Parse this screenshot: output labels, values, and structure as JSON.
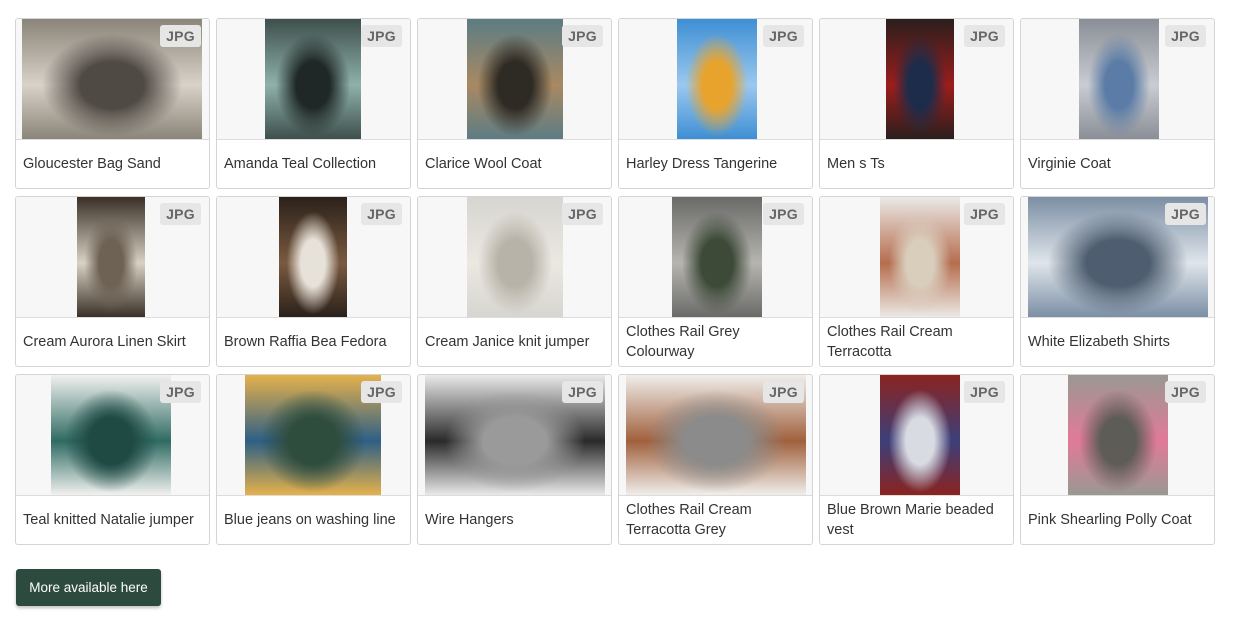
{
  "products": [
    {
      "name": "Gloucester Bag Sand",
      "badge": "JPG",
      "image": "white handbag on wall",
      "colors": [
        "#8a8479",
        "#d8d2c8",
        "#4f4a44"
      ]
    },
    {
      "name": "Amanda Teal Collection",
      "badge": "JPG",
      "image": "two women in teal suits",
      "colors": [
        "#3e4f4c",
        "#8fb1aa",
        "#1f2826"
      ]
    },
    {
      "name": "Clarice Wool Coat",
      "badge": "JPG",
      "image": "woman in camel coat",
      "colors": [
        "#5d7c84",
        "#a88962",
        "#2e2a24"
      ]
    },
    {
      "name": "Harley Dress Tangerine",
      "badge": "JPG",
      "image": "orange dress against sky",
      "colors": [
        "#3f8fd4",
        "#9ac8ee",
        "#e8a32c"
      ]
    },
    {
      "name": "Men s Ts",
      "badge": "JPG",
      "image": "folded t-shirts",
      "colors": [
        "#2a1f1d",
        "#9b1d1d",
        "#1d2c4a"
      ]
    },
    {
      "name": "Virginie Coat",
      "badge": "JPG",
      "image": "woman in blue coat at cathedral",
      "colors": [
        "#8a8e96",
        "#c9ccd2",
        "#5b7ca6"
      ]
    },
    {
      "name": "Cream Aurora Linen Skirt",
      "badge": "JPG",
      "image": "linen skirt",
      "colors": [
        "#3a3027",
        "#d9d2c4",
        "#6e6255"
      ]
    },
    {
      "name": "Brown Raffia Bea Fedora",
      "badge": "JPG",
      "image": "brown fedora hat",
      "colors": [
        "#2b211a",
        "#7a5a40",
        "#e7e2d9"
      ]
    },
    {
      "name": "Cream Janice knit jumper",
      "badge": "JPG",
      "image": "cream knit jumper",
      "colors": [
        "#d7d5d0",
        "#ebe8e2",
        "#b8b3a8"
      ]
    },
    {
      "name": "Clothes Rail Grey Colourway",
      "badge": "JPG",
      "image": "clothes rail with plant",
      "colors": [
        "#6a6a68",
        "#b6b5b0",
        "#3d4a38"
      ]
    },
    {
      "name": "Clothes Rail Cream Terracotta",
      "badge": "JPG",
      "image": "clothes rail cream terracotta",
      "colors": [
        "#ebe9e6",
        "#b56d4e",
        "#d9cdbc"
      ]
    },
    {
      "name": "White Elizabeth Shirts",
      "badge": "JPG",
      "image": "white shirts on hangers",
      "colors": [
        "#7c8fa4",
        "#dfe5eb",
        "#4e5e70"
      ]
    },
    {
      "name": "Teal knitted Natalie jumper",
      "badge": "JPG",
      "image": "teal knitted jumper",
      "colors": [
        "#f1f1ef",
        "#2f6b63",
        "#1f4a44"
      ]
    },
    {
      "name": "Blue jeans on washing line",
      "badge": "JPG",
      "image": "jeans hanging on line",
      "colors": [
        "#e5b14b",
        "#2d5f86",
        "#2f4d3d"
      ]
    },
    {
      "name": "Wire Hangers",
      "badge": "JPG",
      "image": "clothes on wire hangers",
      "colors": [
        "#e9e9e9",
        "#2a2a2a",
        "#9a9a9a"
      ]
    },
    {
      "name": "Clothes Rail Cream Terracotta Grey",
      "badge": "JPG",
      "image": "clothes rail cream terracotta grey",
      "colors": [
        "#f0eeeb",
        "#a0603c",
        "#8b8b8b"
      ]
    },
    {
      "name": "Blue Brown Marie beaded vest",
      "badge": "JPG",
      "image": "woman in beaded vest",
      "colors": [
        "#8a2420",
        "#3c3f7a",
        "#d9dbe3"
      ]
    },
    {
      "name": "Pink Shearling Polly Coat",
      "badge": "JPG",
      "image": "woman in pink coat",
      "colors": [
        "#9a9892",
        "#e17a99",
        "#5e5c57"
      ]
    }
  ],
  "more_button": {
    "label": "More available here",
    "color": "#2d4a3e"
  }
}
